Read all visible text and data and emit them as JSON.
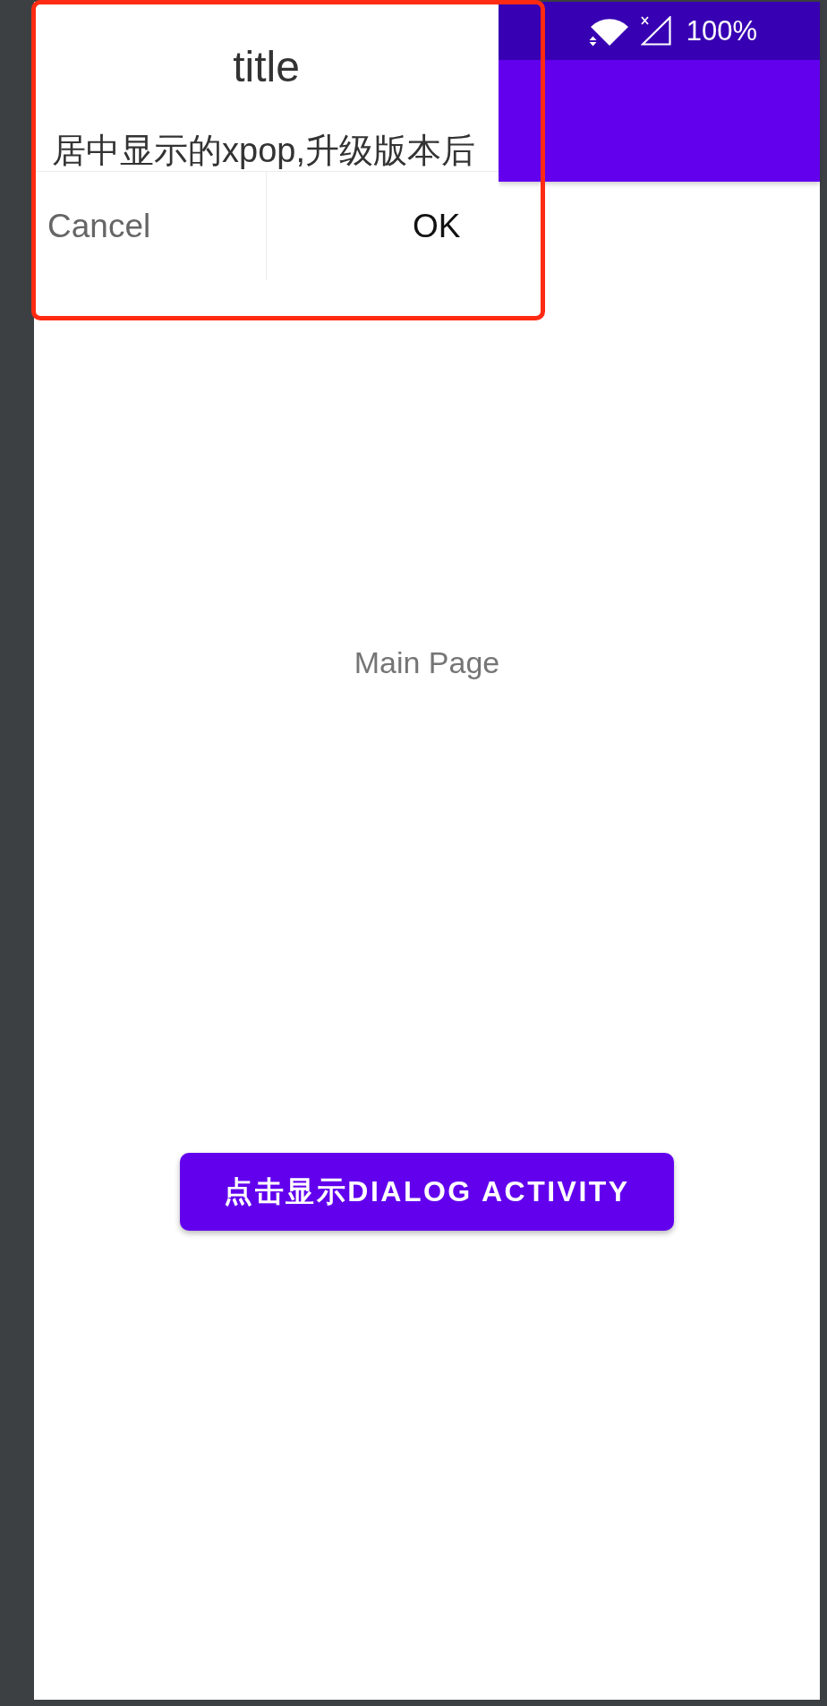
{
  "status_bar": {
    "battery": "100%"
  },
  "dialog": {
    "title": "title",
    "message": "居中显示的xpop,升级版本后",
    "buttons": [
      {
        "label": "Cancel",
        "kind": "cancel"
      },
      {
        "label": "OK",
        "kind": "confirm"
      }
    ]
  },
  "page": {
    "text": "Main Page",
    "button": "点击显示DIALOG ACTIVITY"
  }
}
